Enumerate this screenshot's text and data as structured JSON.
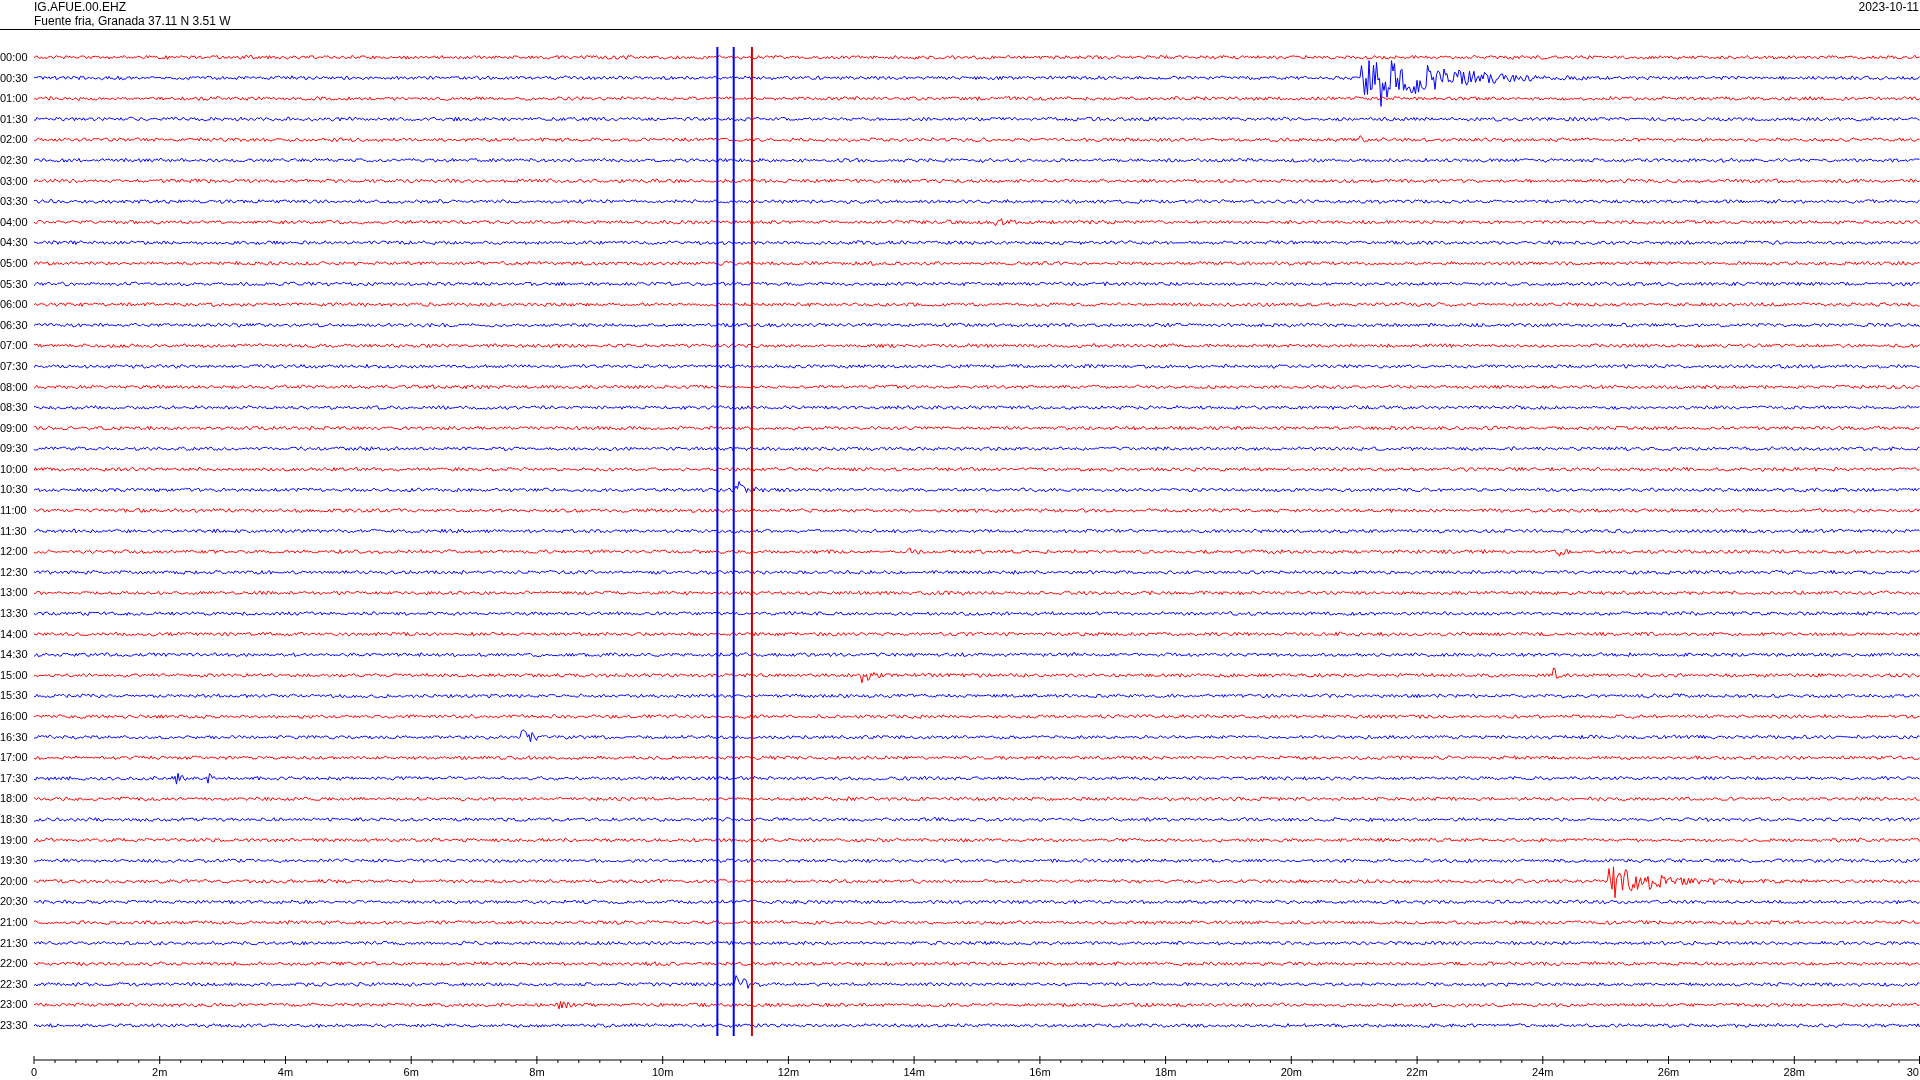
{
  "header": {
    "station": "IG.AFUE.00.EHZ",
    "location": "Fuente fria, Granada  37.11 N 3.51 W",
    "date": "2023-10-11"
  },
  "rows": [
    {
      "label": "00:00",
      "color": "#ff0000"
    },
    {
      "label": "00:30",
      "color": "#0000ff"
    },
    {
      "label": "01:00",
      "color": "#ff0000"
    },
    {
      "label": "01:30",
      "color": "#0000ff"
    },
    {
      "label": "02:00",
      "color": "#ff0000"
    },
    {
      "label": "02:30",
      "color": "#0000ff"
    },
    {
      "label": "03:00",
      "color": "#ff0000"
    },
    {
      "label": "03:30",
      "color": "#0000ff"
    },
    {
      "label": "04:00",
      "color": "#ff0000"
    },
    {
      "label": "04:30",
      "color": "#0000ff"
    },
    {
      "label": "05:00",
      "color": "#ff0000"
    },
    {
      "label": "05:30",
      "color": "#0000ff"
    },
    {
      "label": "06:00",
      "color": "#ff0000"
    },
    {
      "label": "06:30",
      "color": "#0000ff"
    },
    {
      "label": "07:00",
      "color": "#ff0000"
    },
    {
      "label": "07:30",
      "color": "#0000ff"
    },
    {
      "label": "08:00",
      "color": "#ff0000"
    },
    {
      "label": "08:30",
      "color": "#0000ff"
    },
    {
      "label": "09:00",
      "color": "#ff0000"
    },
    {
      "label": "09:30",
      "color": "#0000ff"
    },
    {
      "label": "10:00",
      "color": "#ff0000"
    },
    {
      "label": "10:30",
      "color": "#0000ff"
    },
    {
      "label": "11:00",
      "color": "#ff0000"
    },
    {
      "label": "11:30",
      "color": "#0000ff"
    },
    {
      "label": "12:00",
      "color": "#ff0000"
    },
    {
      "label": "12:30",
      "color": "#0000ff"
    },
    {
      "label": "13:00",
      "color": "#ff0000"
    },
    {
      "label": "13:30",
      "color": "#0000ff"
    },
    {
      "label": "14:00",
      "color": "#ff0000"
    },
    {
      "label": "14:30",
      "color": "#0000ff"
    },
    {
      "label": "15:00",
      "color": "#ff0000"
    },
    {
      "label": "15:30",
      "color": "#0000ff"
    },
    {
      "label": "16:00",
      "color": "#ff0000"
    },
    {
      "label": "16:30",
      "color": "#0000ff"
    },
    {
      "label": "17:00",
      "color": "#ff0000"
    },
    {
      "label": "17:30",
      "color": "#0000ff"
    },
    {
      "label": "18:00",
      "color": "#ff0000"
    },
    {
      "label": "18:30",
      "color": "#0000ff"
    },
    {
      "label": "19:00",
      "color": "#ff0000"
    },
    {
      "label": "19:30",
      "color": "#0000ff"
    },
    {
      "label": "20:00",
      "color": "#ff0000"
    },
    {
      "label": "20:30",
      "color": "#0000ff"
    },
    {
      "label": "21:00",
      "color": "#ff0000"
    },
    {
      "label": "21:30",
      "color": "#0000ff"
    },
    {
      "label": "22:00",
      "color": "#ff0000"
    },
    {
      "label": "22:30",
      "color": "#0000ff"
    },
    {
      "label": "23:00",
      "color": "#ff0000"
    },
    {
      "label": "23:30",
      "color": "#0000ff"
    }
  ],
  "x_axis": {
    "tick_labels": [
      "0",
      "2m",
      "4m",
      "6m",
      "8m",
      "10m",
      "12m",
      "14m",
      "16m",
      "18m",
      "20m",
      "22m",
      "24m",
      "26m",
      "28m",
      "30"
    ]
  }
}
